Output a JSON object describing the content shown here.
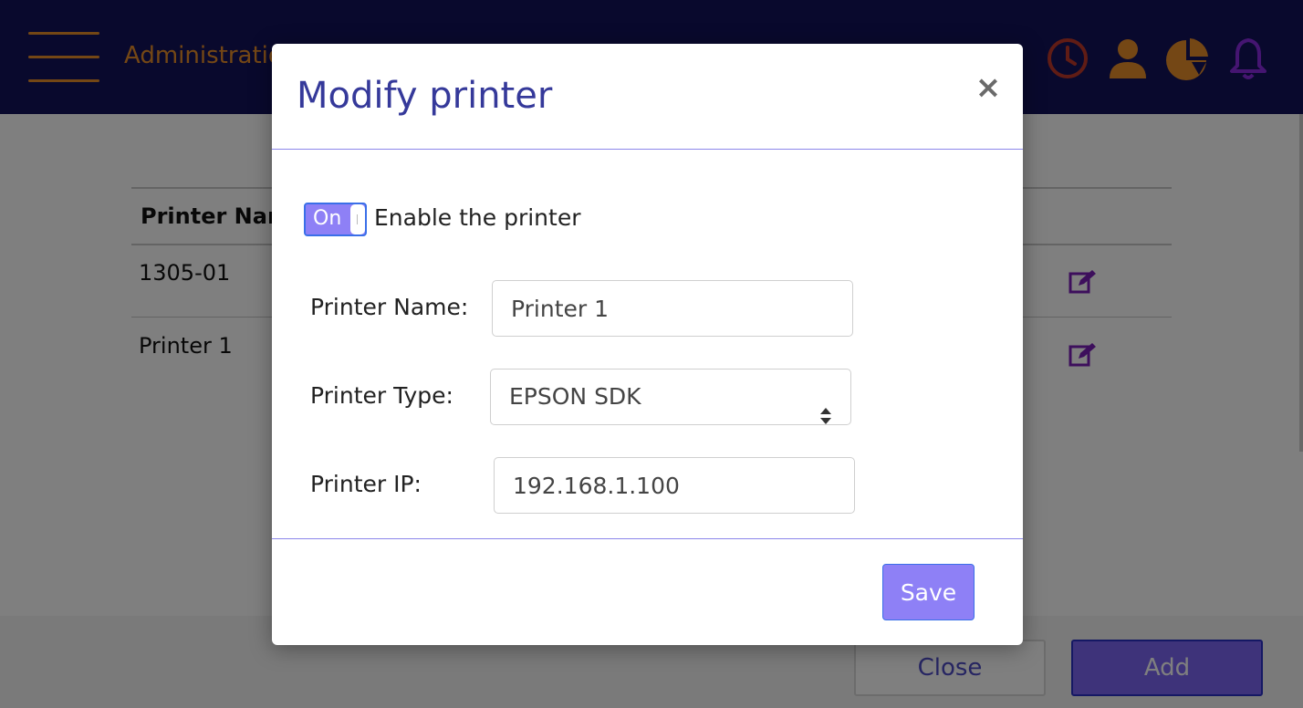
{
  "header": {
    "title": "Administration",
    "icons": [
      "clock-icon",
      "user-icon",
      "pie-chart-icon",
      "bell-icon"
    ],
    "colors": {
      "bar": "#12135b",
      "accent": "#e98e2b",
      "clock": "#c0392b",
      "bell": "#8a2be2"
    }
  },
  "table": {
    "column_header": "Printer Name",
    "rows": [
      {
        "name": "1305-01"
      },
      {
        "name": "Printer 1"
      }
    ]
  },
  "footer": {
    "close_label": "Close",
    "add_label": "Add"
  },
  "modal": {
    "title": "Modify printer",
    "close_glyph": "×",
    "toggle": {
      "label": "On",
      "checked": true,
      "description": "Enable the printer"
    },
    "fields": {
      "name_label": "Printer Name:",
      "name_value": "Printer 1",
      "type_label": "Printer Type:",
      "type_value": "EPSON SDK",
      "ip_label": "Printer IP:",
      "ip_value": "192.168.1.100"
    },
    "save_label": "Save"
  }
}
